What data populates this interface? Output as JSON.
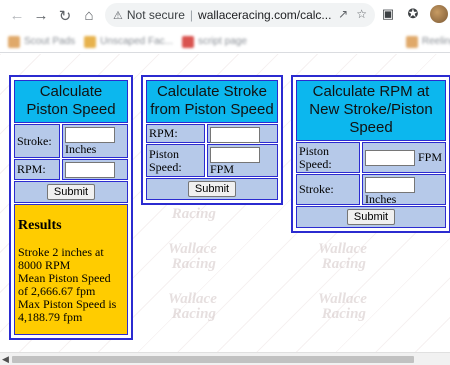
{
  "browser": {
    "security_label": "Not secure",
    "url": "wallaceracing.com/calc...",
    "bookmarks": [
      "Scout Pads",
      "Unscaped Fac...",
      "script page",
      "Reeling"
    ]
  },
  "calculators": [
    {
      "title": "Calculate Piston Speed",
      "fields": [
        {
          "label": "Stroke:",
          "value": "",
          "unit": "Inches"
        },
        {
          "label": "RPM:",
          "value": "",
          "unit": ""
        }
      ],
      "submit_label": "Submit",
      "results": {
        "heading": "Results",
        "lines": [
          "Stroke 2 inches at 8000 RPM",
          "Mean Piston Speed of 2,666.67 fpm",
          "Max Piston Speed is 4,188.79 fpm"
        ]
      }
    },
    {
      "title": "Calculate Stroke from Piston Speed",
      "fields": [
        {
          "label": "RPM:",
          "value": "",
          "unit": ""
        },
        {
          "label": "Piston Speed:",
          "value": "",
          "unit": "FPM"
        }
      ],
      "submit_label": "Submit"
    },
    {
      "title": "Calculate RPM at New Stroke/Piston Speed",
      "fields": [
        {
          "label": "Piston Speed:",
          "value": "",
          "unit": "FPM"
        },
        {
          "label": "Stroke:",
          "value": "",
          "unit": "Inches"
        }
      ],
      "submit_label": "Submit"
    }
  ],
  "watermark_text": "Wallace Racing"
}
